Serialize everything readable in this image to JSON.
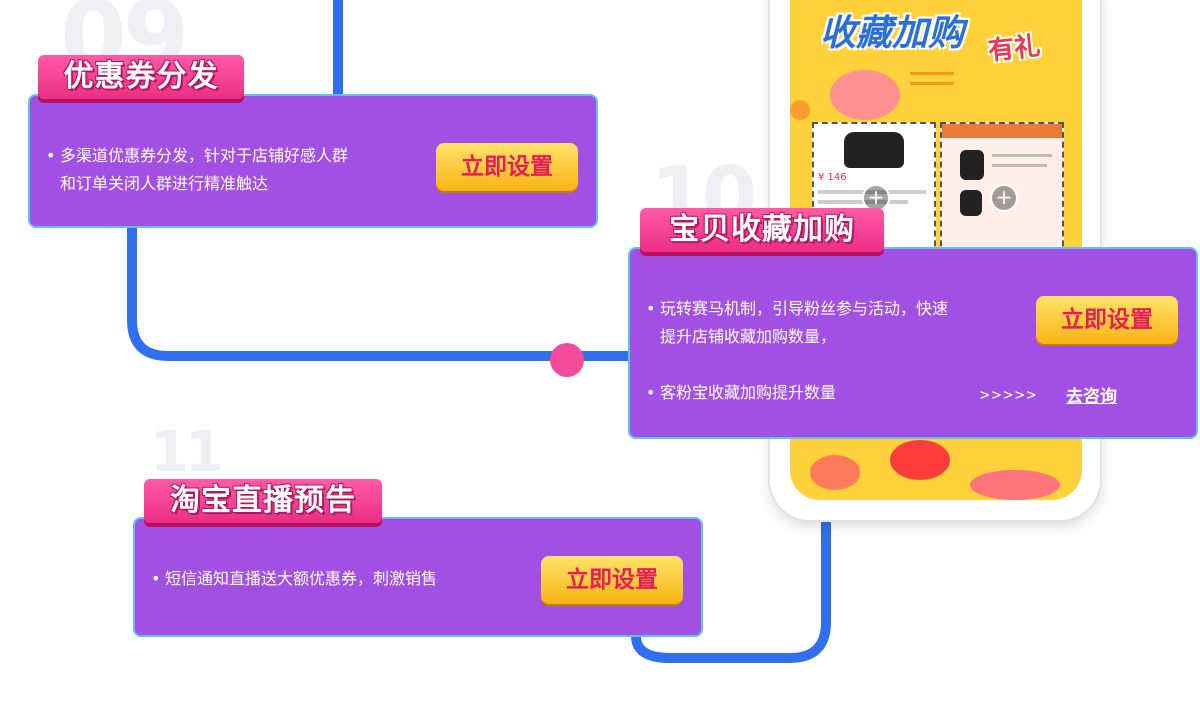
{
  "background_numbers": {
    "n09": "09",
    "n10": "10",
    "n11": "11"
  },
  "phone": {
    "headline": "收藏加购",
    "headline_suffix": "有礼",
    "product_price": "¥ 146"
  },
  "sections": [
    {
      "title": "优惠券分发",
      "lines": [
        "多渠道优惠券分发，针对于店铺好感人群",
        "和订单关闭人群进行精准触达"
      ],
      "button": "立即设置"
    },
    {
      "title": "宝贝收藏加购",
      "lines": [
        "玩转赛马机制，引导粉丝参与活动，快速",
        "提升店铺收藏加购数量，"
      ],
      "extra_line": "客粉宝收藏加购提升数量",
      "arrows": ">>>>>",
      "link": "去咨询",
      "button": "立即设置"
    },
    {
      "title": "淘宝直播预告",
      "lines": [
        "短信通知直播送大额优惠券，刺激销售"
      ],
      "button": "立即设置"
    }
  ],
  "colors": {
    "card_bg": "#a24fe3",
    "card_border": "#5ec2f0",
    "flow_line": "#2f6ff0",
    "tab_pink": "#ec2e85",
    "button_orange": "#f8b312",
    "button_text": "#e51e5a"
  }
}
